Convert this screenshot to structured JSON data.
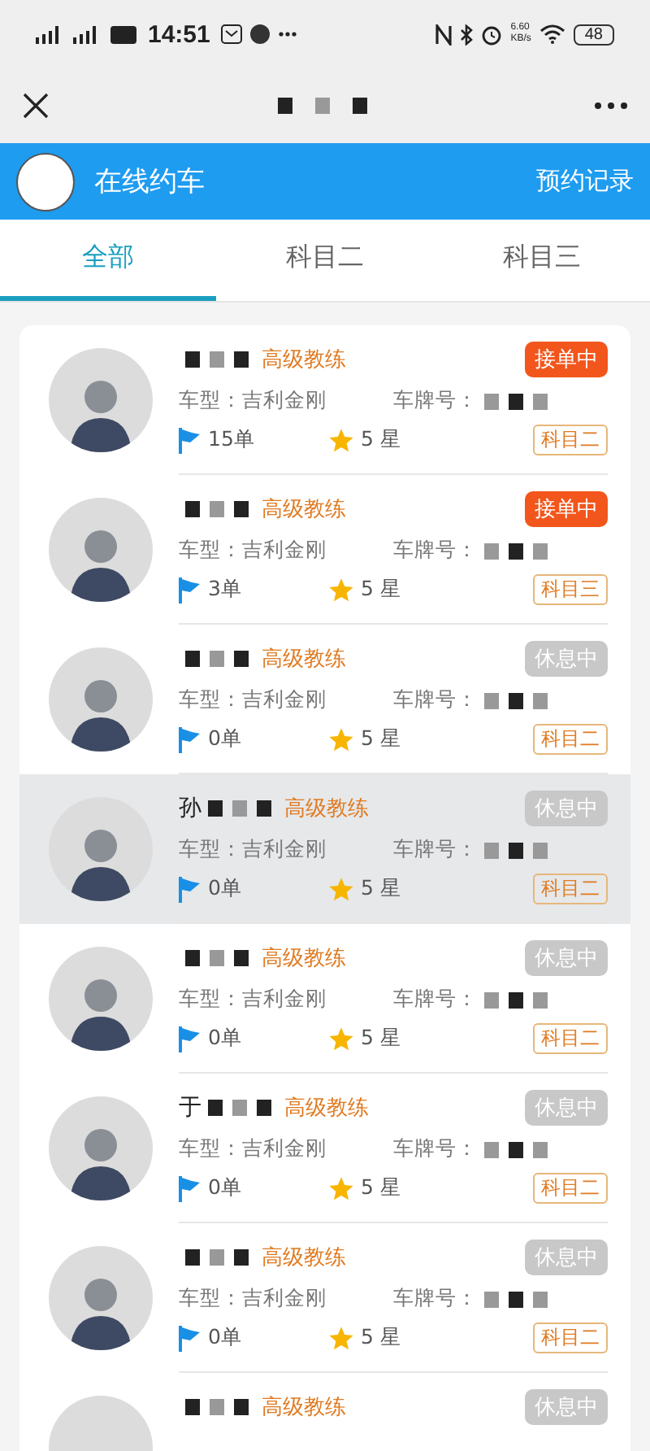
{
  "status_bar": {
    "time": "14:51",
    "network_speed": "6.60",
    "speed_unit": "KB/s",
    "battery": "48"
  },
  "header": {
    "title": "在线约车",
    "action": "预约记录"
  },
  "tabs": [
    {
      "label": "全部",
      "selected": true
    },
    {
      "label": "科目二",
      "selected": false
    },
    {
      "label": "科目三",
      "selected": false
    }
  ],
  "coaches": [
    {
      "title": "高级教练",
      "car_label": "车型：",
      "car": "吉利金刚",
      "plate_label": "车牌号：",
      "orders": "15单",
      "rating": "5 星",
      "status": "接单中",
      "accepting": true,
      "subject": "科目二",
      "selected": false
    },
    {
      "title": "高级教练",
      "car_label": "车型：",
      "car": "吉利金刚",
      "plate_label": "车牌号：",
      "orders": "3单",
      "rating": "5 星",
      "status": "接单中",
      "accepting": true,
      "subject": "科目三",
      "selected": false
    },
    {
      "title": "高级教练",
      "car_label": "车型：",
      "car": "吉利金刚",
      "plate_label": "车牌号：",
      "orders": "0单",
      "rating": "5 星",
      "status": "休息中",
      "accepting": false,
      "subject": "科目二",
      "selected": false
    },
    {
      "name": "孙",
      "title": "高级教练",
      "car_label": "车型：",
      "car": "吉利金刚",
      "plate_label": "车牌号：",
      "orders": "0单",
      "rating": "5 星",
      "status": "休息中",
      "accepting": false,
      "subject": "科目二",
      "selected": true
    },
    {
      "title": "高级教练",
      "car_label": "车型：",
      "car": "吉利金刚",
      "plate_label": "车牌号：",
      "orders": "0单",
      "rating": "5 星",
      "status": "休息中",
      "accepting": false,
      "subject": "科目二",
      "selected": false
    },
    {
      "name": "于",
      "title": "高级教练",
      "car_label": "车型：",
      "car": "吉利金刚",
      "plate_label": "车牌号：",
      "orders": "0单",
      "rating": "5 星",
      "status": "休息中",
      "accepting": false,
      "subject": "科目二",
      "selected": false
    },
    {
      "title": "高级教练",
      "car_label": "车型：",
      "car": "吉利金刚",
      "plate_label": "车牌号：",
      "orders": "0单",
      "rating": "5 星",
      "status": "休息中",
      "accepting": false,
      "subject": "科目二",
      "selected": false
    },
    {
      "title": "高级教练",
      "status": "休息中",
      "accepting": false,
      "selected": false
    }
  ]
}
